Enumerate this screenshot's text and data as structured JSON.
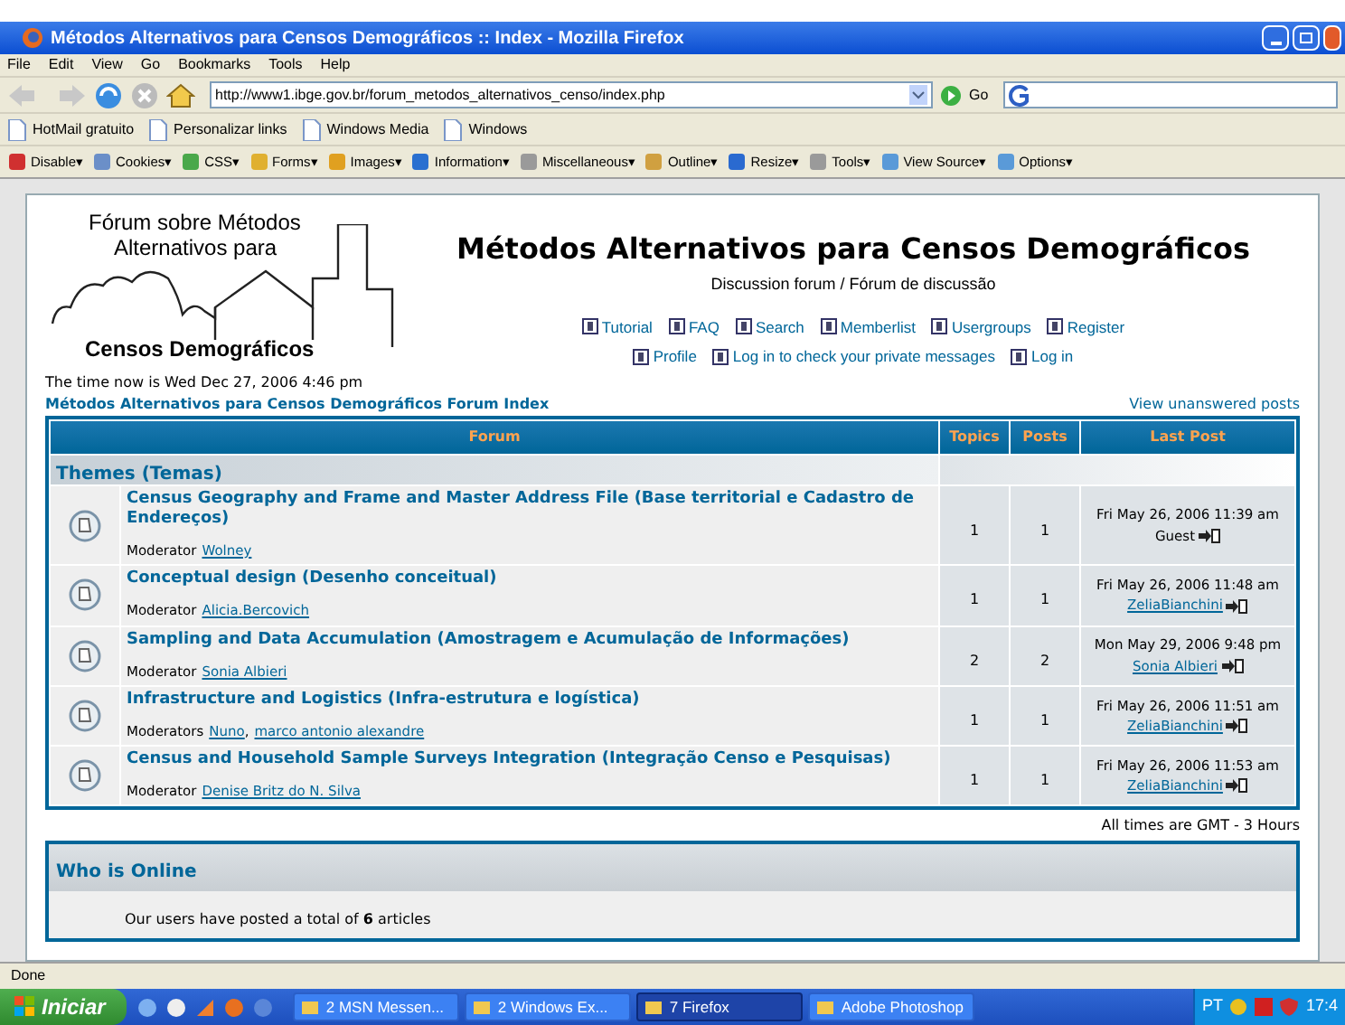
{
  "window": {
    "title": "Métodos Alternativos para Censos Demográficos :: Index - Mozilla Firefox"
  },
  "menu": [
    "File",
    "Edit",
    "View",
    "Go",
    "Bookmarks",
    "Tools",
    "Help"
  ],
  "navigation": {
    "address": "http://www1.ibge.gov.br/forum_metodos_alternativos_censo/index.php",
    "go": "Go"
  },
  "bookmarks": [
    "HotMail gratuito",
    "Personalizar links",
    "Windows Media",
    "Windows"
  ],
  "developer_toolbar": [
    "Disable▾",
    "Cookies▾",
    "CSS▾",
    "Forms▾",
    "Images▾",
    "Information▾",
    "Miscellaneous▾",
    "Outline▾",
    "Resize▾",
    "Tools▾",
    "View Source▾",
    "Options▾"
  ],
  "page": {
    "logo": {
      "line_1": "Fórum sobre Métodos",
      "line_2": "Alternativos para",
      "line_3": "Censos Demográficos"
    },
    "site_title": "Métodos Alternativos para Censos Demográficos",
    "description": "Discussion forum / Fórum de discussão",
    "nav_links": [
      [
        "Tutorial",
        "FAQ",
        "Search",
        "Memberlist",
        "Usergroups",
        "Register"
      ],
      [
        "Profile",
        "Log in to check your private messages",
        "Log in"
      ]
    ],
    "current_time": "The time now is Wed Dec 27, 2006 4:46 pm",
    "index_link": "Métodos Alternativos para Censos Demográficos Forum Index",
    "unanswered_link": "View unanswered posts",
    "table": {
      "columns": [
        "Forum",
        "Topics",
        "Posts",
        "Last Post"
      ],
      "category": "Themes (Temas)",
      "forums": [
        {
          "title": "Census Geography and Frame and Master Address File (Base territorial e Cadastro de Endereços)",
          "moderator_label": "Moderator",
          "moderators": [
            "Wolney"
          ],
          "topics": "1",
          "posts": "1",
          "last_post_date": "Fri May 26, 2006 11:39 am",
          "last_post_author": "Guest",
          "author_is_link": false
        },
        {
          "title": "Conceptual design (Desenho conceitual)",
          "moderator_label": "Moderator",
          "moderators": [
            "Alicia.Bercovich"
          ],
          "topics": "1",
          "posts": "1",
          "last_post_date": "Fri May 26, 2006 11:48 am",
          "last_post_author": "ZeliaBianchini",
          "author_is_link": true
        },
        {
          "title": "Sampling and Data Accumulation (Amostragem e Acumulação de Informações)",
          "moderator_label": "Moderator",
          "moderators": [
            "Sonia Albieri"
          ],
          "topics": "2",
          "posts": "2",
          "last_post_date": "Mon May 29, 2006 9:48 pm",
          "last_post_author": "Sonia Albieri",
          "author_is_link": true
        },
        {
          "title": "Infrastructure and Logistics (Infra-estrutura e logística)",
          "moderator_label": "Moderators",
          "moderators": [
            "Nuno",
            "marco antonio alexandre"
          ],
          "moderator_separator": ",",
          "topics": "1",
          "posts": "1",
          "last_post_date": "Fri May 26, 2006 11:51 am",
          "last_post_author": "ZeliaBianchini",
          "author_is_link": true
        },
        {
          "title": "Census and Household Sample Surveys Integration (Integração Censo e Pesquisas)",
          "moderator_label": "Moderator",
          "moderators": [
            "Denise Britz do N. Silva"
          ],
          "topics": "1",
          "posts": "1",
          "last_post_date": "Fri May 26, 2006 11:53 am",
          "last_post_author": "ZeliaBianchini",
          "author_is_link": true
        }
      ]
    },
    "timezone": "All times are GMT - 3 Hours",
    "who_is_online": {
      "title": "Who is Online",
      "stats": "Our users have posted a total of **6** articles"
    }
  },
  "status_bar": "Done",
  "taskbar": {
    "start": "Iniciar",
    "tasks": [
      {
        "label": "2 MSN Messen...",
        "selected": false
      },
      {
        "label": "2 Windows Ex...",
        "selected": false
      },
      {
        "label": "7 Firefox",
        "selected": true
      },
      {
        "label": "Adobe Photoshop",
        "selected": false
      }
    ],
    "language": "PT",
    "clock": "17:4"
  }
}
